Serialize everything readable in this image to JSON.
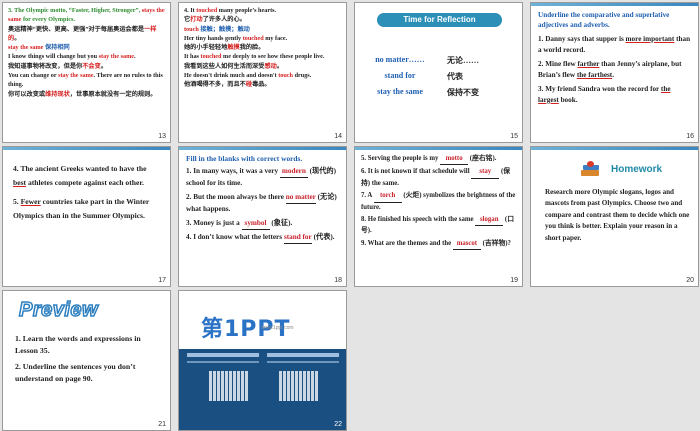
{
  "slides": [
    {
      "number": "13",
      "lines": [
        {
          "parts": [
            {
              "text": "3. The Olympic motto, “Faster, Higher, Stronger”, ",
              "cls": "green"
            },
            {
              "text": "stays the same",
              "cls": "red"
            },
            {
              "text": " for every Olympics.",
              "cls": "green"
            }
          ]
        },
        {
          "parts": [
            {
              "text": "奥运精神“更快、更高、更强”对于每届奥运会都是",
              "cls": ""
            },
            {
              "text": "一样的",
              "cls": "red"
            },
            {
              "text": "。",
              "cls": ""
            }
          ]
        },
        {
          "parts": [
            {
              "text": "stay the same",
              "cls": "red"
            },
            {
              "text": "          ",
              "cls": ""
            },
            {
              "text": "保持相同",
              "cls": "blue"
            }
          ]
        },
        {
          "parts": [
            {
              "text": "I know things will change but you ",
              "cls": ""
            },
            {
              "text": "stay the same",
              "cls": "red"
            },
            {
              "text": ".",
              "cls": ""
            }
          ]
        },
        {
          "parts": [
            {
              "text": "我知道事物将改变，但是你",
              "cls": ""
            },
            {
              "text": "不会变",
              "cls": "red"
            },
            {
              "text": "。",
              "cls": ""
            }
          ]
        },
        {
          "parts": [
            {
              "text": "You can change or ",
              "cls": ""
            },
            {
              "text": "stay the same",
              "cls": "red"
            },
            {
              "text": ". There are no rules to this thing.",
              "cls": ""
            }
          ]
        },
        {
          "parts": [
            {
              "text": "你可以改变或",
              "cls": ""
            },
            {
              "text": "维持现状",
              "cls": "red"
            },
            {
              "text": "，世事原本就没有一定的规则。",
              "cls": ""
            }
          ]
        }
      ]
    },
    {
      "number": "14",
      "lines": [
        {
          "parts": [
            {
              "text": "4. It ",
              "cls": ""
            },
            {
              "text": "touched",
              "cls": "red"
            },
            {
              "text": " many people’s hearts.",
              "cls": ""
            }
          ]
        },
        {
          "parts": [
            {
              "text": "它",
              "cls": ""
            },
            {
              "text": "打动",
              "cls": "red"
            },
            {
              "text": "了许多人的心。",
              "cls": ""
            }
          ]
        },
        {
          "parts": [
            {
              "text": "touch",
              "cls": "red"
            },
            {
              "text": "   接触；触摸；触动",
              "cls": "blue"
            }
          ]
        },
        {
          "parts": [
            {
              "text": "Her tiny hands gently ",
              "cls": ""
            },
            {
              "text": "touched",
              "cls": "red"
            },
            {
              "text": " my face.",
              "cls": ""
            }
          ]
        },
        {
          "parts": [
            {
              "text": "她的小手轻轻地",
              "cls": ""
            },
            {
              "text": "触摸",
              "cls": "red"
            },
            {
              "text": "我的脸。",
              "cls": ""
            }
          ]
        },
        {
          "parts": [
            {
              "text": "It has ",
              "cls": ""
            },
            {
              "text": "touched",
              "cls": "red"
            },
            {
              "text": " me deeply to see how these people live.",
              "cls": ""
            }
          ]
        },
        {
          "parts": [
            {
              "text": "我看到这些人如何生活而深受",
              "cls": ""
            },
            {
              "text": "感动",
              "cls": "red"
            },
            {
              "text": "。",
              "cls": ""
            }
          ]
        },
        {
          "parts": [
            {
              "text": "He doesn't drink much and doesn't ",
              "cls": ""
            },
            {
              "text": "touch",
              "cls": "red"
            },
            {
              "text": " drugs.",
              "cls": ""
            }
          ]
        },
        {
          "parts": [
            {
              "text": "他酒喝得不多，而且不",
              "cls": ""
            },
            {
              "text": "碰",
              "cls": "red"
            },
            {
              "text": "毒品。",
              "cls": ""
            }
          ]
        }
      ]
    },
    {
      "number": "15",
      "title": "Time for Reflection",
      "rows": [
        {
          "en": "no matter……",
          "zh": "无论……"
        },
        {
          "en": "stand for",
          "zh": "代表"
        },
        {
          "en": "stay the same",
          "zh": "保持不变"
        }
      ]
    },
    {
      "number": "16",
      "heading": "Underline the comparative and superlative adjectives and adverbs.",
      "items": [
        {
          "parts": [
            {
              "text": "1. Danny says that supper is ",
              "u": false
            },
            {
              "text": "more important",
              "u": true
            },
            {
              "text": " than a world record.",
              "u": false
            }
          ]
        },
        {
          "parts": [
            {
              "text": "2. Mine flew ",
              "u": false
            },
            {
              "text": "farther",
              "u": true
            },
            {
              "text": " than Jenny’s airplane, but Brian’s flew ",
              "u": false
            },
            {
              "text": "the farthest",
              "u": true
            },
            {
              "text": ".",
              "u": false
            }
          ]
        },
        {
          "parts": [
            {
              "text": "3. My friend Sandra won the record for ",
              "u": false
            },
            {
              "text": "the largest",
              "u": true
            },
            {
              "text": " book.",
              "u": false
            }
          ]
        }
      ]
    },
    {
      "number": "17",
      "items": [
        {
          "parts": [
            {
              "text": "4. The ancient Greeks wanted to have the ",
              "u": false
            },
            {
              "text": "best",
              "u": true
            },
            {
              "text": " athletes compete against each other.",
              "u": false
            }
          ]
        },
        {
          "parts": [
            {
              "text": "5. ",
              "u": false
            },
            {
              "text": "Fewer",
              "u": true
            },
            {
              "text": " countries take part in the Winter Olympics than in the Summer Olympics.",
              "u": false
            }
          ]
        }
      ]
    },
    {
      "number": "18",
      "heading": "Fill in the blanks with correct words.",
      "items": [
        {
          "before": "1. In many ways, it was a very ",
          "answer": "modern",
          "after": " (现代的) school for its time."
        },
        {
          "before": "2. But the moon always be there ",
          "answer": "no matter",
          "after": " (无论) what happens."
        },
        {
          "before": "3. Money is just a ",
          "answer": "symbol",
          "after": " (象征)."
        },
        {
          "before": "4. I don’t know what  the letters ",
          "answer": "stand for",
          "after": " (代表)."
        }
      ]
    },
    {
      "number": "19",
      "items": [
        {
          "before": "5. Serving the people is my ",
          "answer": "motto",
          "after": " (座右铭)."
        },
        {
          "before": "6. It is not known if that schedule will ",
          "answer": "stay",
          "after": " (保持) the same."
        },
        {
          "before": "7. A ",
          "answer": "torch",
          "after": " (火炬) symbolizes the brightness of the future."
        },
        {
          "before": "8. He finished his speech with the same ",
          "answer": "slogan",
          "after": " (口号)."
        },
        {
          "before": "9. What are the themes and the ",
          "answer": "mascot",
          "after": " (吉祥物)?"
        }
      ]
    },
    {
      "number": "20",
      "title": "Homework",
      "body": "Research more Olympic slogans, logos and mascots from past Olympics. Choose two and compare and contrast them to decide which one you think is better. Explain your reason in a short paper."
    },
    {
      "number": "21",
      "title": "Preview",
      "items": [
        "1. Learn the words and expressions in Lesson 35.",
        "2. Underline the sentences you don’t understand on page 90."
      ]
    },
    {
      "number": "22",
      "logo": "第1PPT",
      "url": "www.1ppt.com"
    }
  ],
  "colors": {
    "accent_red": "#d61f1f",
    "accent_blue": "#1f5fb0",
    "accent_green": "#2e8b2e",
    "teal": "#1f8aa8"
  }
}
